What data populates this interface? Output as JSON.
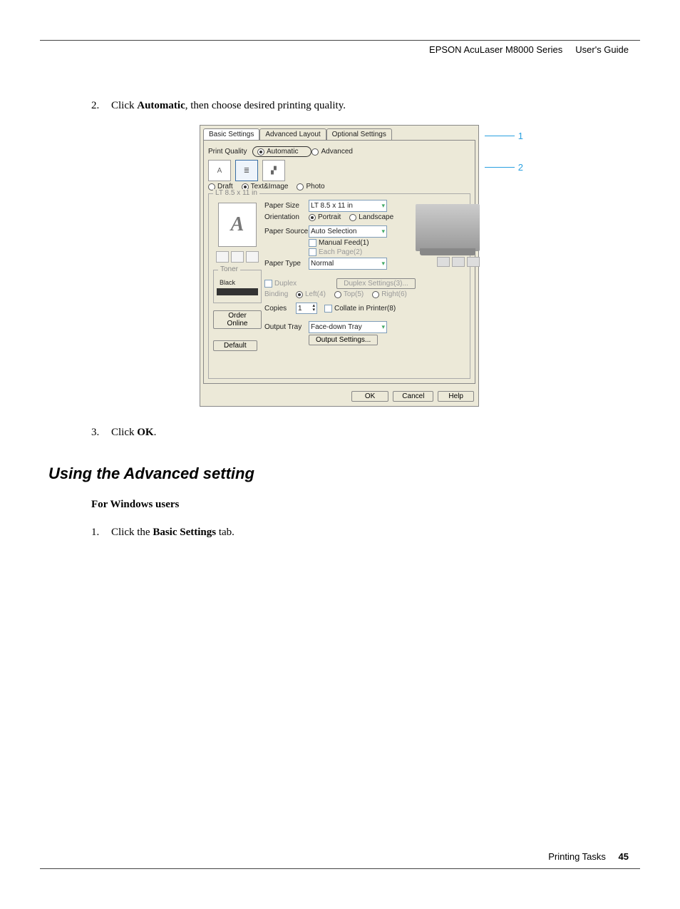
{
  "header": {
    "product": "EPSON AcuLaser M8000 Series",
    "doc": "User's Guide"
  },
  "steps": {
    "s2_num": "2.",
    "s2_pre": "Click ",
    "s2_bold": "Automatic",
    "s2_post": ", then choose desired printing quality.",
    "s3_num": "3.",
    "s3_pre": "Click ",
    "s3_bold": "OK",
    "s3_post": "."
  },
  "heading": "Using the Advanced setting",
  "subheading": "For Windows users",
  "steps2": {
    "s1_num": "1.",
    "s1_pre": "Click the ",
    "s1_bold": "Basic Settings",
    "s1_post": " tab."
  },
  "dialog": {
    "tabs": {
      "t0": "Basic Settings",
      "t1": "Advanced Layout",
      "t2": "Optional Settings"
    },
    "printQualityLabel": "Print Quality",
    "automatic": "Automatic",
    "advanced": "Advanced",
    "draft": "Draft",
    "textimage": "Text&Image",
    "photo": "Photo",
    "paperSizeDisplay": "LT 8.5 x 11 in",
    "paperSizeLbl": "Paper Size",
    "paperSizeVal": "LT 8.5 x 11 in",
    "orientationLbl": "Orientation",
    "portrait": "Portrait",
    "landscape": "Landscape",
    "paperSourceLbl": "Paper Source",
    "paperSourceVal": "Auto Selection",
    "manualFeed": "Manual Feed(1)",
    "eachPage": "Each Page(2)",
    "paperTypeLbl": "Paper Type",
    "paperTypeVal": "Normal",
    "tonerLbl": "Toner",
    "black": "Black",
    "orderOnline": "Order Online",
    "defaultBtn": "Default",
    "duplex": "Duplex",
    "duplexSettings": "Duplex Settings(3)...",
    "binding": "Binding",
    "bindLeft": "Left(4)",
    "bindTop": "Top(5)",
    "bindRight": "Right(6)",
    "copies": "Copies",
    "copiesVal": "1",
    "collate": "Collate in Printer(8)",
    "outputTrayLbl": "Output Tray",
    "outputTrayVal": "Face-down Tray",
    "outputSettings": "Output Settings...",
    "ok": "OK",
    "cancel": "Cancel",
    "help": "Help",
    "paperPreviewGlyph": "A"
  },
  "callouts": {
    "c1": "1",
    "c2": "2"
  },
  "footer": {
    "section": "Printing Tasks",
    "page": "45"
  }
}
